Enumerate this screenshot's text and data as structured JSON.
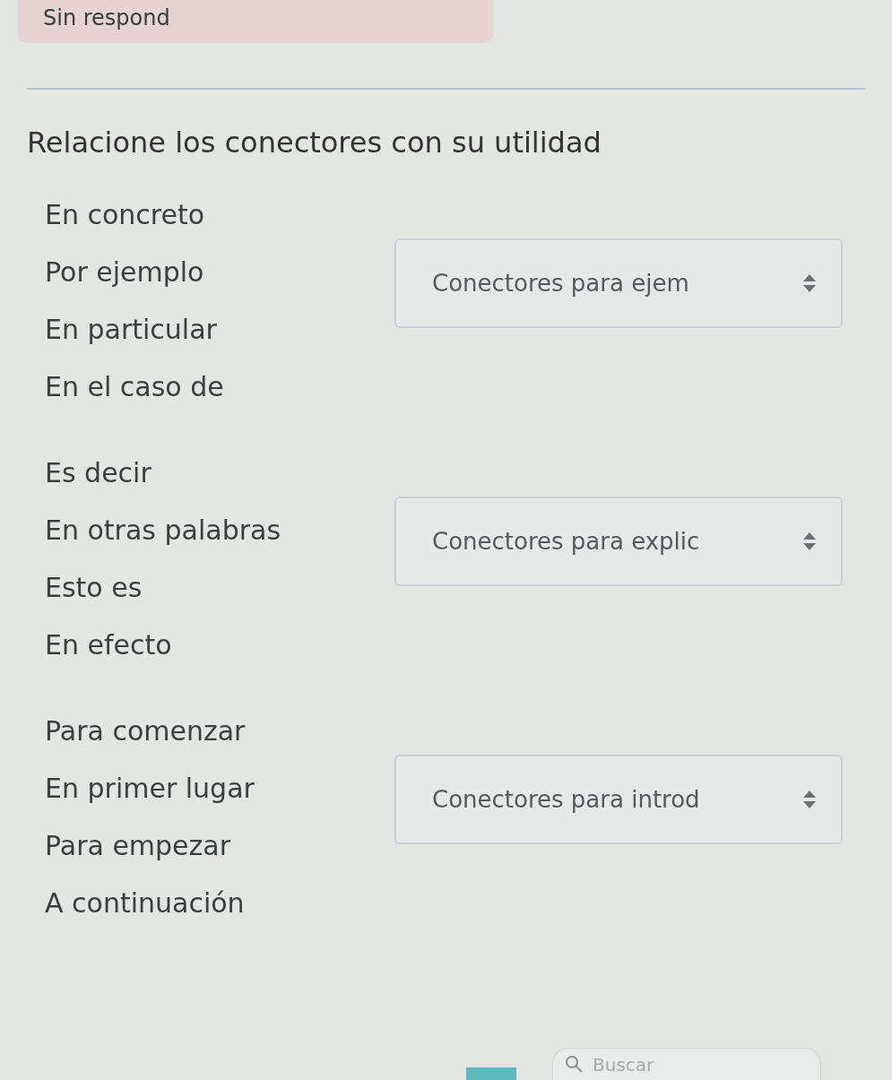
{
  "status_badge": {
    "text": "Sin respond"
  },
  "question": {
    "text": "Relacione los conectores con su utilidad"
  },
  "groups": [
    {
      "items": [
        "En concreto",
        "Por ejemplo",
        "En particular",
        "En el caso de"
      ],
      "answer": {
        "value": "Conectores para ejem"
      }
    },
    {
      "items": [
        "Es decir",
        "En otras palabras",
        "Esto es",
        "En efecto"
      ],
      "answer": {
        "value": "Conectores para explic"
      }
    },
    {
      "items": [
        "Para comenzar",
        "En primer lugar",
        "Para empezar",
        "A continuación"
      ],
      "answer": {
        "value": "Conectores para introd"
      }
    }
  ],
  "footer": {
    "search": {
      "placeholder": "Buscar"
    }
  }
}
